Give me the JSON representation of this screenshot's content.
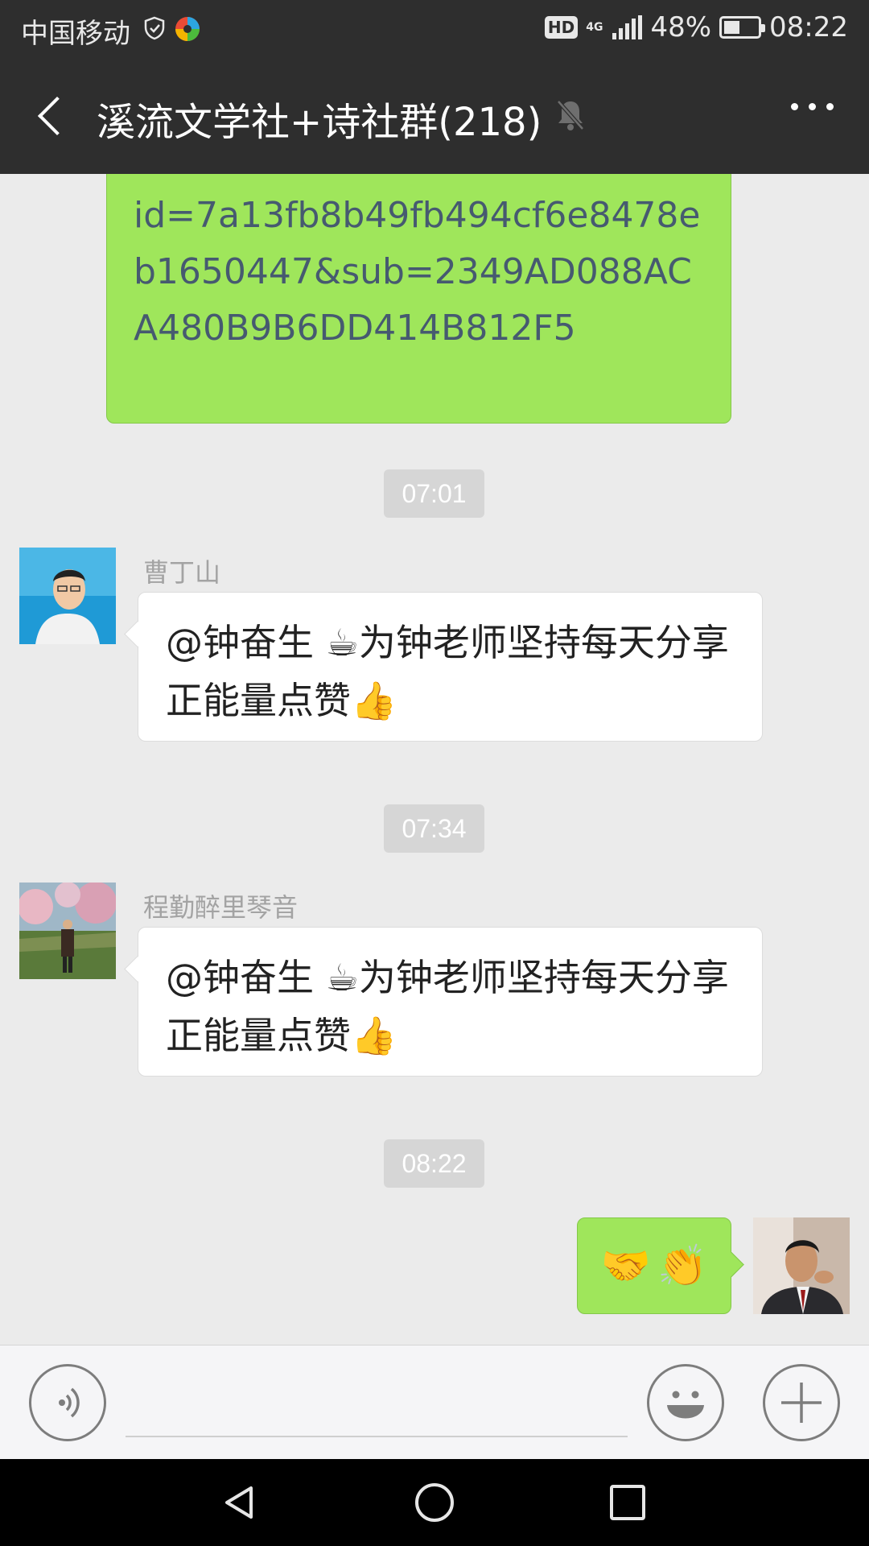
{
  "status_bar": {
    "carrier": "中国移动",
    "network": "4G",
    "hd": "HD",
    "battery_percent": "48%",
    "battery_level": 0.48,
    "time": "08:22"
  },
  "header": {
    "title": "溪流文学社+诗社群(218)",
    "muted": true
  },
  "messages": {
    "link_fragment": "id=7a13fb8b49fb494cf6e8478eb1650447&sub=2349AD088ACA480B9B6DD414B812F5",
    "time1": "07:01",
    "msg1": {
      "sender": "曹丁山",
      "mention": "@钟奋生",
      "coffee": "☕",
      "text": "为钟老师坚持每天分享正能量点赞",
      "thumbs": "👍"
    },
    "time2": "07:34",
    "msg2": {
      "sender": "程勤醉里琴音",
      "mention": "@钟奋生",
      "coffee": "☕",
      "text": "为钟老师坚持每天分享正能量点赞",
      "thumbs": "👍"
    },
    "time3": "08:22",
    "msg3": {
      "handshake": "🤝",
      "clap": "👏"
    }
  },
  "input_bar": {
    "placeholder": ""
  },
  "icons": {
    "back": "back-icon",
    "mute": "bell-off-icon",
    "more": "more-icon",
    "voice": "voice-icon",
    "emoji": "smiley-icon",
    "plus": "plus-icon"
  },
  "colors": {
    "bar_bg": "#2e2e2e",
    "chat_bg": "#ebebeb",
    "sent_bubble": "#9fe65b",
    "link_text": "#465a70"
  }
}
